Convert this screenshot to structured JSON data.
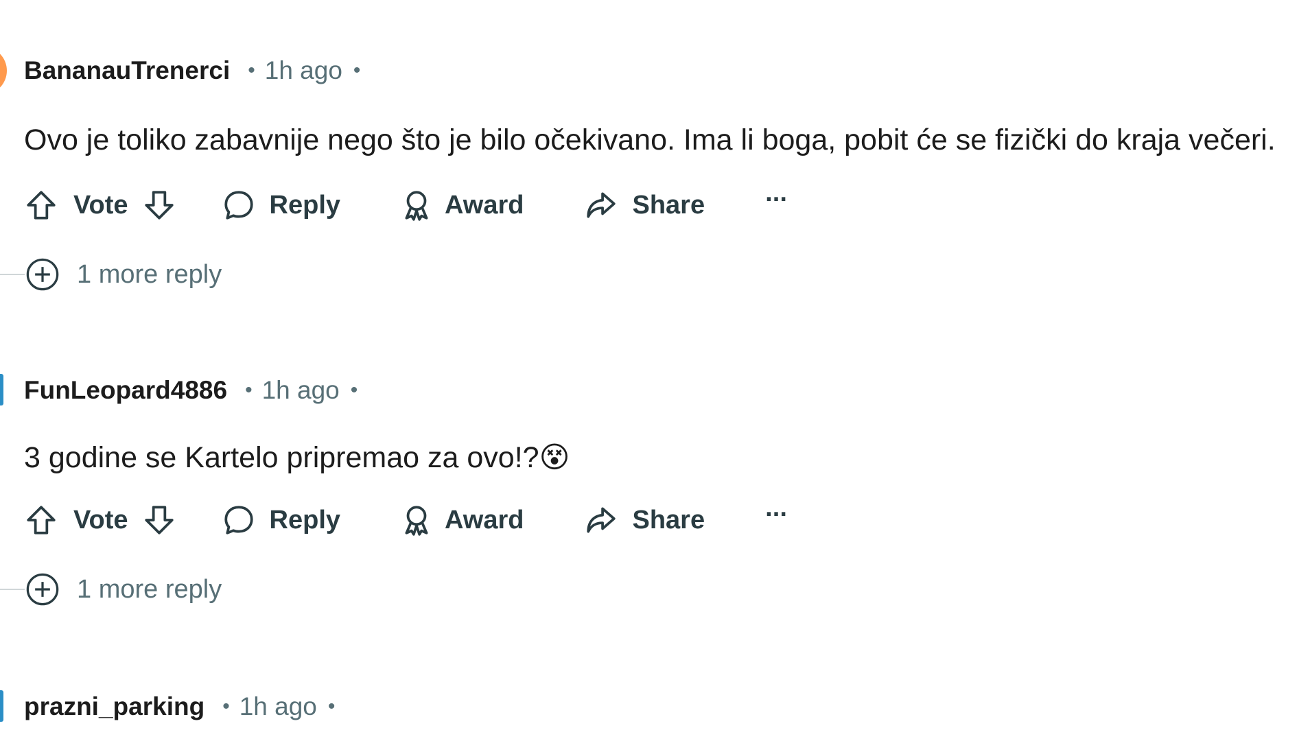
{
  "comments": [
    {
      "username": "BananauTrenerci",
      "time": "1h ago",
      "body": "Ovo je toliko zabavnije nego što je bilo očekivano. Ima li boga, pobit će se fizički do kraja večeri.",
      "actions": {
        "vote": "Vote",
        "reply": "Reply",
        "award": "Award",
        "share": "Share",
        "more": "···"
      },
      "more_replies": "1 more reply"
    },
    {
      "username": "FunLeopard4886",
      "time": "1h ago",
      "body": "3 godine se Kartelo pripremao za ovo!?",
      "emoji": "😵",
      "actions": {
        "vote": "Vote",
        "reply": "Reply",
        "award": "Award",
        "share": "Share",
        "more": "···"
      },
      "more_replies": "1 more reply"
    },
    {
      "username": "prazni_parking",
      "time": "1h ago"
    }
  ],
  "separator": "•",
  "colors": {
    "text": "#1c1c1c",
    "muted": "#576f76",
    "action": "#2a3c42",
    "avatar_orange": "#ff9a4d",
    "avatar_blue": "#2b8ec6"
  }
}
